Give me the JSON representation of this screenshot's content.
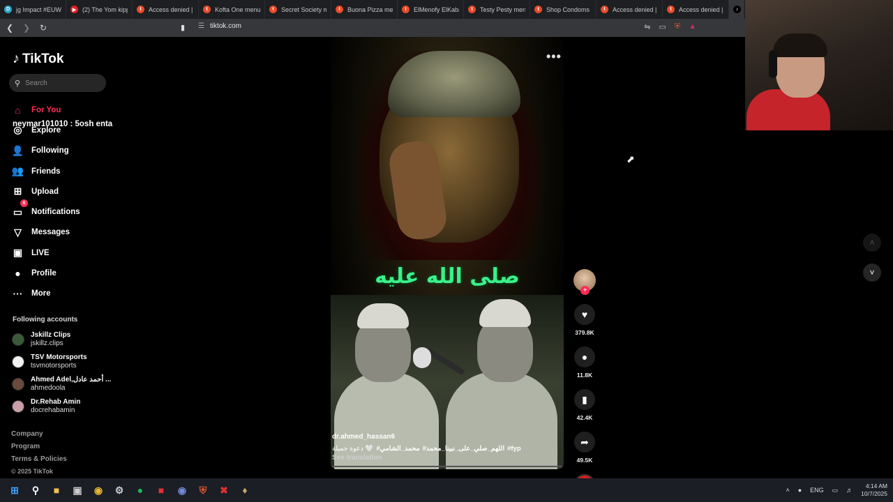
{
  "browser": {
    "tabs": [
      {
        "title": "jg Impact #EUW",
        "icon": "D",
        "color": "#2aa7c9"
      },
      {
        "title": "(2) The Yom kipp",
        "icon": "▶",
        "color": "#e02020"
      },
      {
        "title": "Access denied | w",
        "icon": "t",
        "color": "#e84b2a"
      },
      {
        "title": "Kofta One menu",
        "icon": "t",
        "color": "#e84b2a"
      },
      {
        "title": "Secret Society m",
        "icon": "t",
        "color": "#e84b2a"
      },
      {
        "title": "Buona Pizza men",
        "icon": "t",
        "color": "#e84b2a"
      },
      {
        "title": "ElMenofy ElKabab",
        "icon": "t",
        "color": "#e84b2a"
      },
      {
        "title": "Testy Pesty menu",
        "icon": "t",
        "color": "#e84b2a"
      },
      {
        "title": "Shop Condoms C",
        "icon": "t",
        "color": "#e84b2a"
      },
      {
        "title": "Access denied | w",
        "icon": "t",
        "color": "#e84b2a"
      },
      {
        "title": "Access denied | w",
        "icon": "t",
        "color": "#e84b2a"
      }
    ],
    "url": "tiktok.com"
  },
  "sidebar": {
    "logo": "TikTok",
    "search_placeholder": "Search",
    "nav": [
      {
        "label": "For You",
        "icon": "home-icon",
        "glyph": "⌂"
      },
      {
        "label": "Explore",
        "icon": "compass-icon",
        "glyph": "◎"
      },
      {
        "label": "Following",
        "icon": "person-add-icon",
        "glyph": "👤"
      },
      {
        "label": "Friends",
        "icon": "friends-icon",
        "glyph": "👥"
      },
      {
        "label": "Upload",
        "icon": "upload-icon",
        "glyph": "⊞"
      },
      {
        "label": "Notifications",
        "icon": "inbox-icon",
        "glyph": "▭",
        "badge": "6"
      },
      {
        "label": "Messages",
        "icon": "send-icon",
        "glyph": "▽"
      },
      {
        "label": "LIVE",
        "icon": "live-icon",
        "glyph": "▣"
      },
      {
        "label": "Profile",
        "icon": "profile-icon",
        "glyph": "●"
      },
      {
        "label": "More",
        "icon": "more-icon",
        "glyph": "···"
      }
    ],
    "overlay_comment": "neymar101010 : 5osh enta",
    "following_title": "Following accounts",
    "accounts": [
      {
        "name": "Jskillz Clips",
        "username": "jskillz.clips",
        "avatar_color": "#3a5a3a"
      },
      {
        "name": "TSV Motorsports",
        "username": "tsvmotorsports",
        "avatar_color": "#f2f2f2"
      },
      {
        "name": "Ahmed Adel,أحمد عادل ...",
        "username": "ahmedoola",
        "avatar_color": "#6a4a3a"
      },
      {
        "name": "Dr.Rehab Amin",
        "username": "docrehabamin",
        "avatar_color": "#c9a0a8"
      }
    ],
    "footer": [
      "Company",
      "Program",
      "Terms & Policies"
    ],
    "copyright": "© 2025 TikTok"
  },
  "video": {
    "overlay_text": "صلى الله عليه",
    "username": "dr.ahmed_hassan6",
    "caption_prefix": "دعوة جميلة 🤍",
    "hashtags": [
      "#محمد_الشامي",
      "#اللهم_صلي_على_نبينا_محمد",
      "#fyp"
    ],
    "see_translation": "See translation",
    "likes": "379.8K",
    "comments": "11.8K",
    "saves": "42.4K",
    "shares": "49.5K"
  },
  "taskbar": {
    "language": "ENG",
    "time": "4:14 AM",
    "date": "10/7/2025"
  }
}
